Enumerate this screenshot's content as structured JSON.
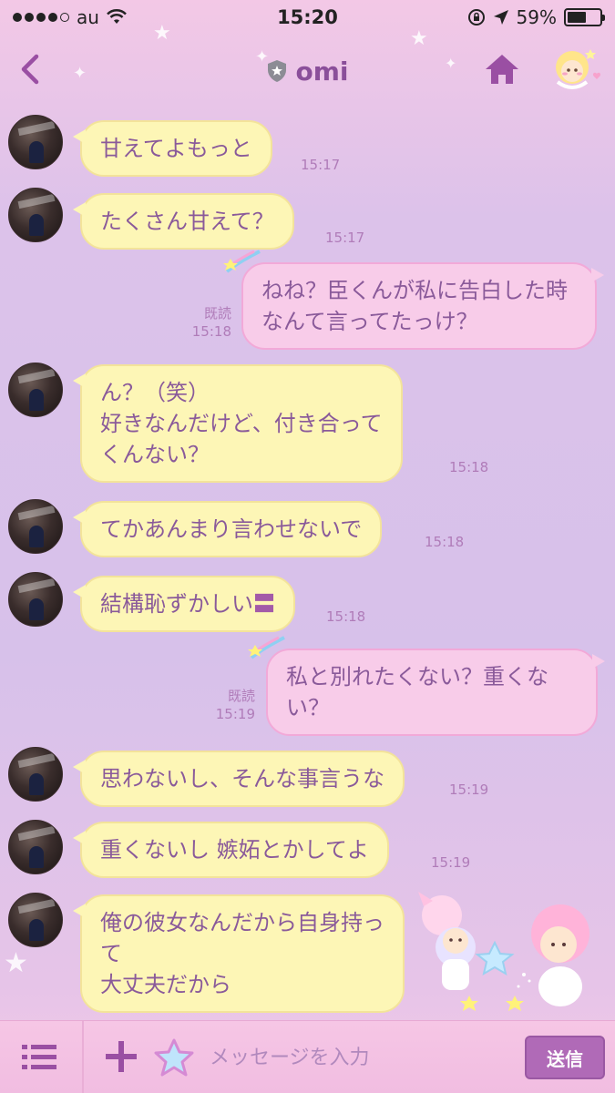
{
  "status_bar": {
    "carrier": "au",
    "time": "15:20",
    "battery_text": "59%",
    "battery_level": 0.59
  },
  "header": {
    "title": "omi"
  },
  "messages": [
    {
      "side": "in",
      "text": "甘えてよもっと",
      "time": "15:17"
    },
    {
      "side": "in",
      "text": "たくさん甘えて？",
      "time": "15:17"
    },
    {
      "side": "out",
      "text": "ねね？臣くんが私に告白した時なんて言ってたっけ？",
      "read": "既読",
      "time": "15:18"
    },
    {
      "side": "in",
      "text": "ん？（笑）\n好きなんだけど、付き合って\nくんない？",
      "time": "15:18"
    },
    {
      "side": "in",
      "text": "てかあんまり言わせないで",
      "time": "15:18"
    },
    {
      "side": "in",
      "text": "結構恥ずかしい",
      "emoji": "〓",
      "time": "15:18"
    },
    {
      "side": "out",
      "text": "私と別れたくない？重くない？",
      "read": "既読",
      "time": "15:19"
    },
    {
      "side": "in",
      "text": "思わないし、そんな事言うな",
      "time": "15:19"
    },
    {
      "side": "in",
      "text": "重くないし 嫉妬とかしてよ",
      "time": "15:19"
    },
    {
      "side": "in",
      "text": "俺の彼女なんだから自身持っ\nて\n大丈夫だから",
      "time": ""
    }
  ],
  "input_bar": {
    "placeholder": "メッセージを入力",
    "send_label": "送信"
  },
  "colors": {
    "incoming_bubble": "#fdf6b6",
    "outgoing_bubble": "#f8cce9",
    "text": "#8a5a9a",
    "send_button": "#b06ab7"
  }
}
